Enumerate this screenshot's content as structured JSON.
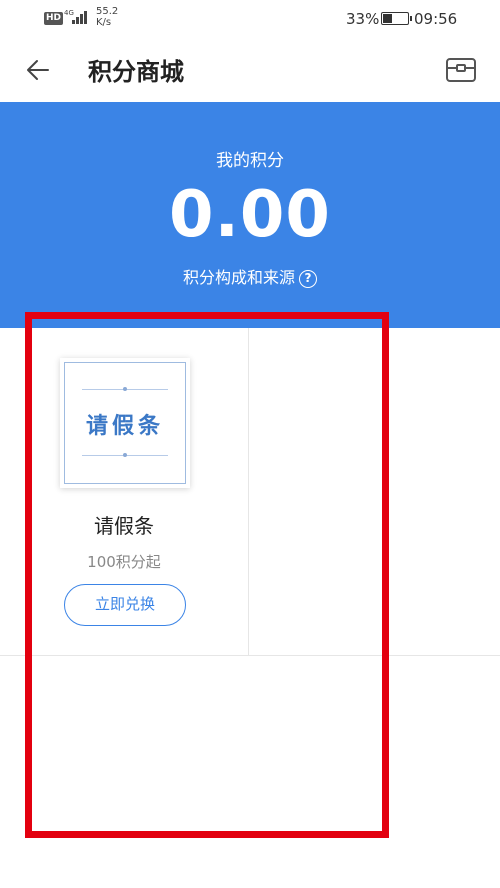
{
  "status_bar": {
    "hd": "HD",
    "network": "4G",
    "speed_value": "55.2",
    "speed_unit": "K/s",
    "battery_percent": "33%",
    "time": "09:56",
    "battery_level": 0.33
  },
  "nav": {
    "title": "积分商城",
    "back_icon": "back-arrow-icon",
    "record_icon": "wallet-icon"
  },
  "header": {
    "label": "我的积分",
    "points": "0.00",
    "source_link": "积分构成和来源",
    "help_icon": "?"
  },
  "products": [
    {
      "image_text": "请假条",
      "name": "请假条",
      "price": "100积分起",
      "button_label": "立即兑换"
    }
  ],
  "colors": {
    "brand_blue": "#3b84e6",
    "highlight_red": "#e3000f"
  }
}
